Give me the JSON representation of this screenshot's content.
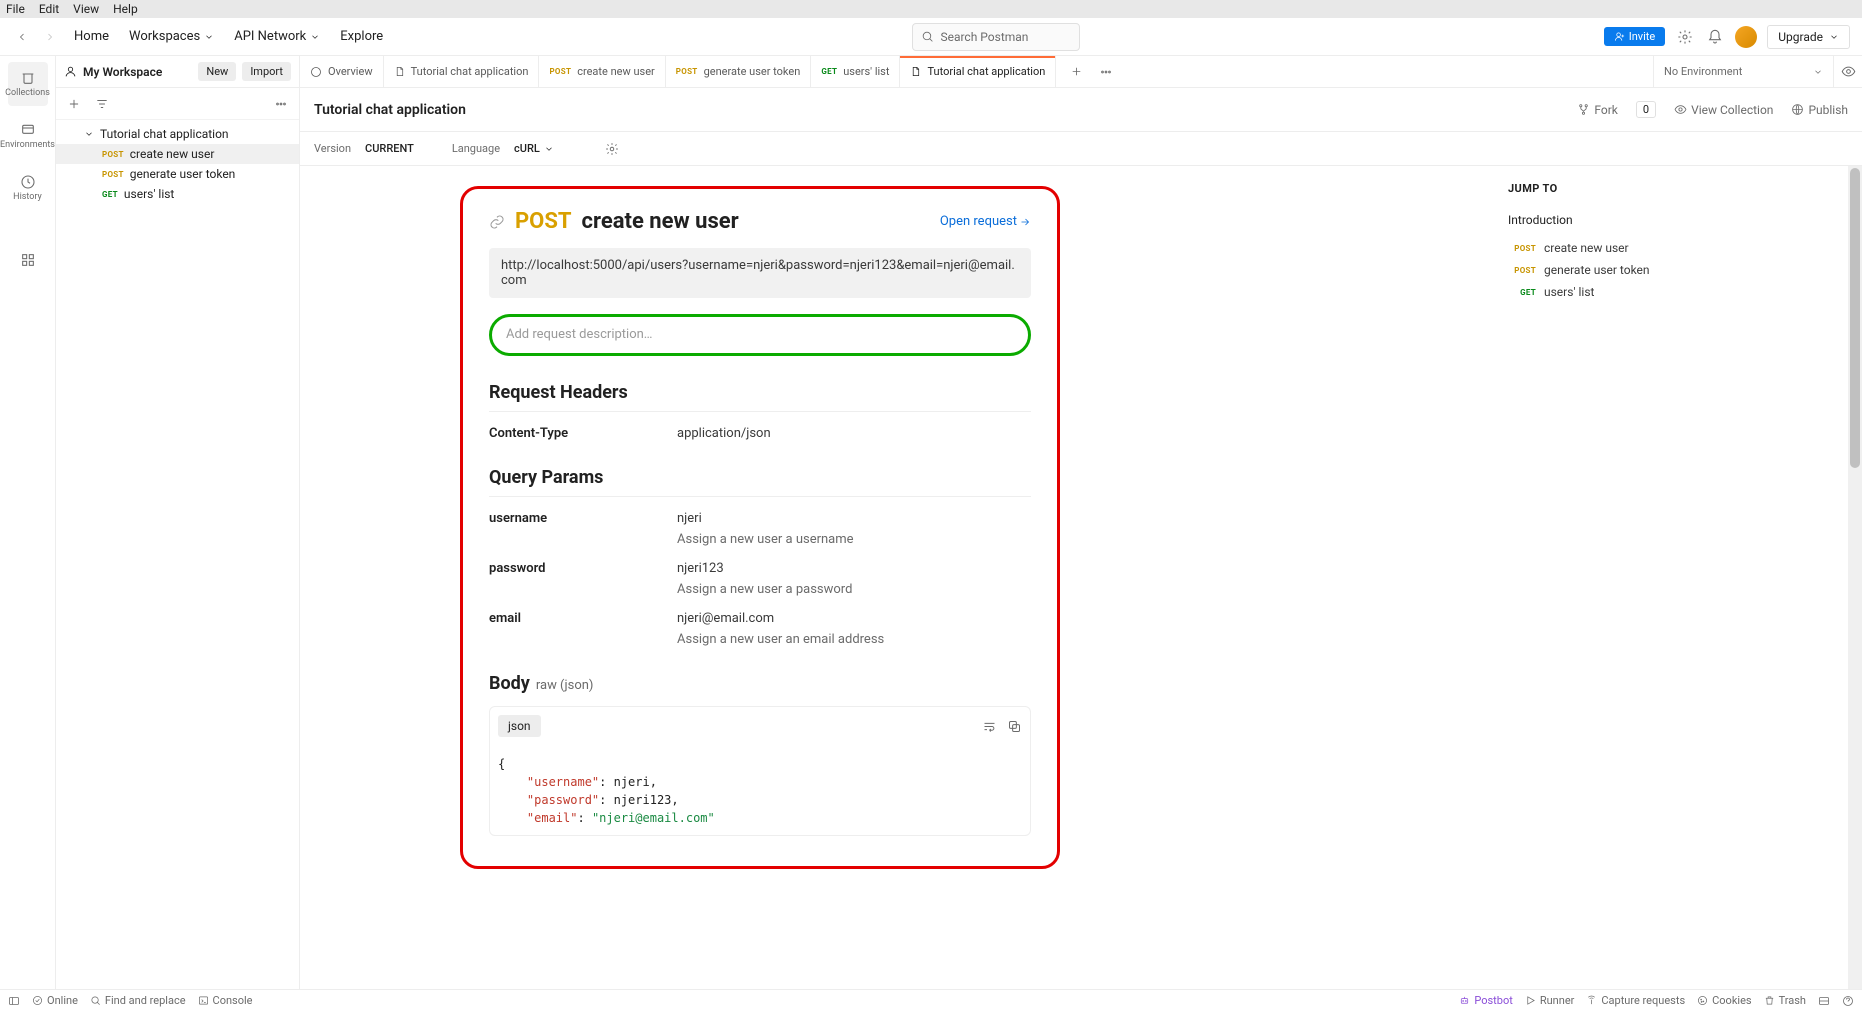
{
  "menubar": [
    "File",
    "Edit",
    "View",
    "Help"
  ],
  "topnav": {
    "home": "Home",
    "workspaces": "Workspaces",
    "api_network": "API Network",
    "explore": "Explore",
    "search_placeholder": "Search Postman",
    "invite": "Invite",
    "upgrade": "Upgrade"
  },
  "sidebar_profile": {
    "collections": "Collections",
    "environments": "Environments",
    "history": "History"
  },
  "workspace": {
    "title": "My Workspace",
    "new": "New",
    "import": "Import",
    "collection": "Tutorial chat application",
    "items": [
      {
        "method": "POST",
        "mclass": "post",
        "label": "create new user",
        "selected": true
      },
      {
        "method": "POST",
        "mclass": "post",
        "label": "generate user token",
        "selected": false
      },
      {
        "method": "GET",
        "mclass": "get",
        "label": "users' list",
        "selected": false
      }
    ]
  },
  "tabs": [
    {
      "type": "overview",
      "label": "Overview"
    },
    {
      "type": "doc",
      "label": "Tutorial chat application"
    },
    {
      "type": "req",
      "method": "POST",
      "mclass": "post",
      "label": "create new user"
    },
    {
      "type": "req",
      "method": "POST",
      "mclass": "post",
      "label": "generate user token"
    },
    {
      "type": "req",
      "method": "GET",
      "mclass": "get",
      "label": "users' list"
    },
    {
      "type": "doc",
      "label": "Tutorial chat application",
      "active": true
    }
  ],
  "env": {
    "label": "No Environment"
  },
  "subheader": {
    "title": "Tutorial chat application",
    "fork": "Fork",
    "fork_count": "0",
    "view": "View Collection",
    "publish": "Publish"
  },
  "subheader2": {
    "version_label": "Version",
    "version_value": "CURRENT",
    "lang_label": "Language",
    "lang_value": "cURL"
  },
  "doc": {
    "method": "POST",
    "name": "create new user",
    "open": "Open request",
    "url": "http://localhost:5000/api/users?username=njeri&password=njeri123&email=njeri@email.com",
    "desc_placeholder": "Add request description…",
    "sec_headers": "Request Headers",
    "headers": [
      {
        "k": "Content-Type",
        "v": "application/json"
      }
    ],
    "sec_params": "Query Params",
    "params": [
      {
        "k": "username",
        "v": "njeri",
        "d": "Assign a new user a username"
      },
      {
        "k": "password",
        "v": "njeri123",
        "d": "Assign a new user a password"
      },
      {
        "k": "email",
        "v": "njeri@email.com",
        "d": "Assign a new user an email address"
      }
    ],
    "sec_body": "Body",
    "body_sub": "raw (json)",
    "body_tab": "json",
    "body_json": {
      "l1": "{",
      "l2k": "\"username\"",
      "l2v": "njeri,",
      "l3k": "\"password\"",
      "l3v": "njeri123,",
      "l4k": "\"email\"",
      "l4v": "\"njeri@email.com\""
    }
  },
  "jump": {
    "title": "JUMP TO",
    "intro": "Introduction",
    "items": [
      {
        "method": "POST",
        "mclass": "post",
        "label": "create new user"
      },
      {
        "method": "POST",
        "mclass": "post",
        "label": "generate user token"
      },
      {
        "method": "GET",
        "mclass": "get",
        "label": "users' list"
      }
    ]
  },
  "footer": {
    "online": "Online",
    "find": "Find and replace",
    "console": "Console",
    "postbot": "Postbot",
    "runner": "Runner",
    "capture": "Capture requests",
    "cookies": "Cookies",
    "trash": "Trash"
  }
}
